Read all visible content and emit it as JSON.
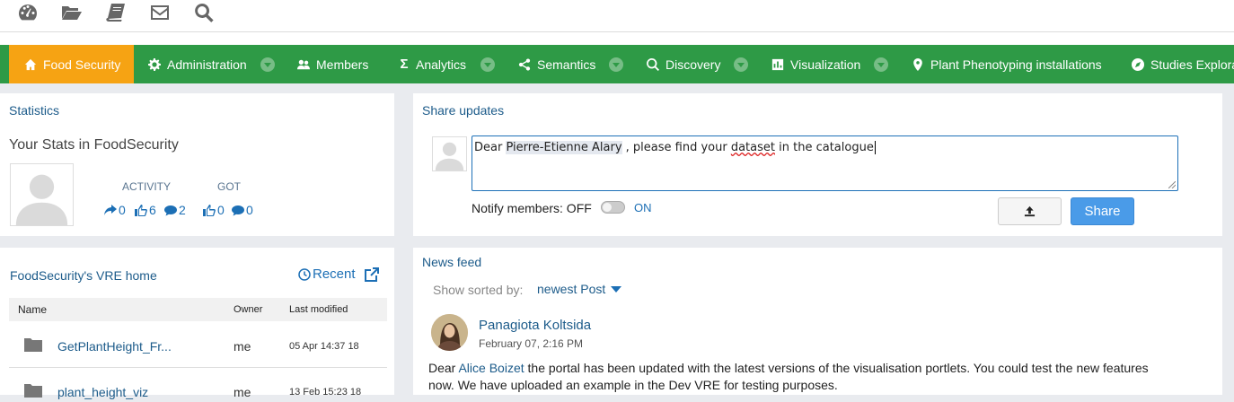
{
  "topbar": {
    "icons": [
      "dashboard-icon",
      "folder-open-icon",
      "book-icon",
      "envelope-icon",
      "search-icon"
    ]
  },
  "nav": {
    "items": [
      {
        "label": "Food Security",
        "icon": "home-icon",
        "active": true
      },
      {
        "label": "Administration",
        "icon": "gear-icon",
        "dropdown": true
      },
      {
        "label": "Members",
        "icon": "users-icon"
      },
      {
        "label": "Analytics",
        "icon": "sigma-icon",
        "dropdown": true
      },
      {
        "label": "Semantics",
        "icon": "share-icon",
        "dropdown": true
      },
      {
        "label": "Discovery",
        "icon": "search-icon",
        "dropdown": true
      },
      {
        "label": "Visualization",
        "icon": "chart-icon",
        "dropdown": true
      },
      {
        "label": "Plant Phenotyping installations",
        "icon": "map-marker-icon"
      },
      {
        "label": "Studies Explora",
        "icon": "compass-icon"
      }
    ],
    "colors": {
      "bar": "#2e9a46",
      "active": "#f6a313"
    }
  },
  "statistics": {
    "title": "Statistics",
    "subtitle": "Your Stats in FoodSecurity",
    "activity_label": "ACTIVITY",
    "got_label": "GOT",
    "activity": {
      "posts": "0",
      "likes": "6",
      "comments": "2"
    },
    "got": {
      "likes": "0",
      "comments": "0"
    }
  },
  "share": {
    "title": "Share updates",
    "text_before": "Dear ",
    "mention": "Pierre-Etienne Alary",
    "text_mid": " , please find your ",
    "misspelled": "dataset",
    "text_after": " in the catalogue",
    "notify_label": "Notify members: OFF",
    "notify_on": "ON",
    "share_button": "Share",
    "accent": "#4a9be8"
  },
  "vre": {
    "title": "FoodSecurity's VRE home",
    "recent": "Recent",
    "columns": {
      "name": "Name",
      "owner": "Owner",
      "modified": "Last modified"
    },
    "rows": [
      {
        "name": "GetPlantHeight_Fr...",
        "owner": "me",
        "modified": "05 Apr 14:37 18"
      },
      {
        "name": "plant_height_viz",
        "owner": "me",
        "modified": "13 Feb 15:23 18"
      }
    ]
  },
  "feed": {
    "title": "News feed",
    "sorted_by_label": "Show sorted by:",
    "sorted_by_value": "newest Post",
    "post": {
      "author": "Panagiota Koltsida",
      "date": "February 07, 2:16 PM",
      "text_before": "Dear ",
      "mention": "Alice Boizet",
      "text_line1": " the portal has been updated with the latest versions of the visualisation portlets. You could test the new features",
      "text_line2": "now. We have uploaded an example in the Dev VRE for testing purposes."
    }
  }
}
